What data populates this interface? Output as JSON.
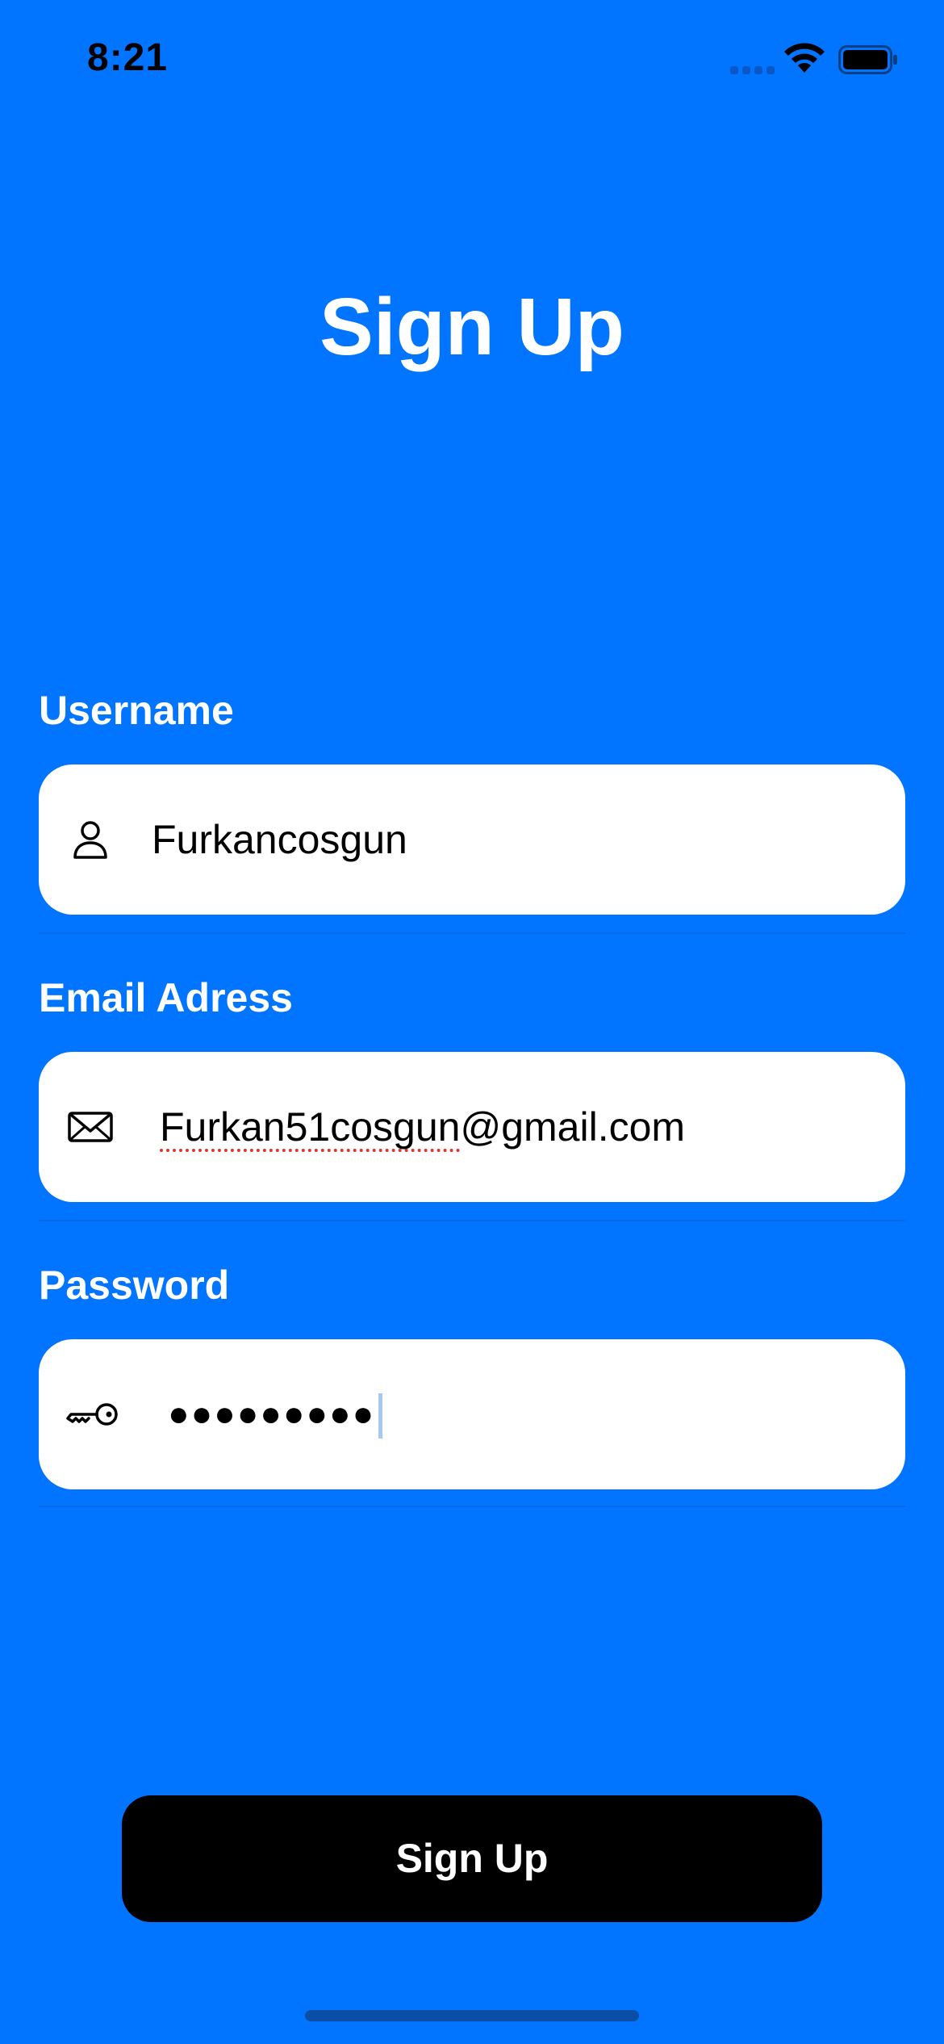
{
  "status_bar": {
    "time": "8:21"
  },
  "page": {
    "title": "Sign Up",
    "background_color": "#0175FF"
  },
  "form": {
    "username": {
      "label": "Username",
      "value": "Furkancosgun",
      "icon": "person-icon"
    },
    "email": {
      "label": "Email Adress",
      "value_misspelled": "Furkan51cosgun",
      "value_rest": "@gmail.com",
      "icon": "envelope-icon"
    },
    "password": {
      "label": "Password",
      "masked_value": "●●●●●●●●●",
      "icon": "key-icon"
    }
  },
  "actions": {
    "signup_label": "Sign Up",
    "button_color": "#000000"
  }
}
